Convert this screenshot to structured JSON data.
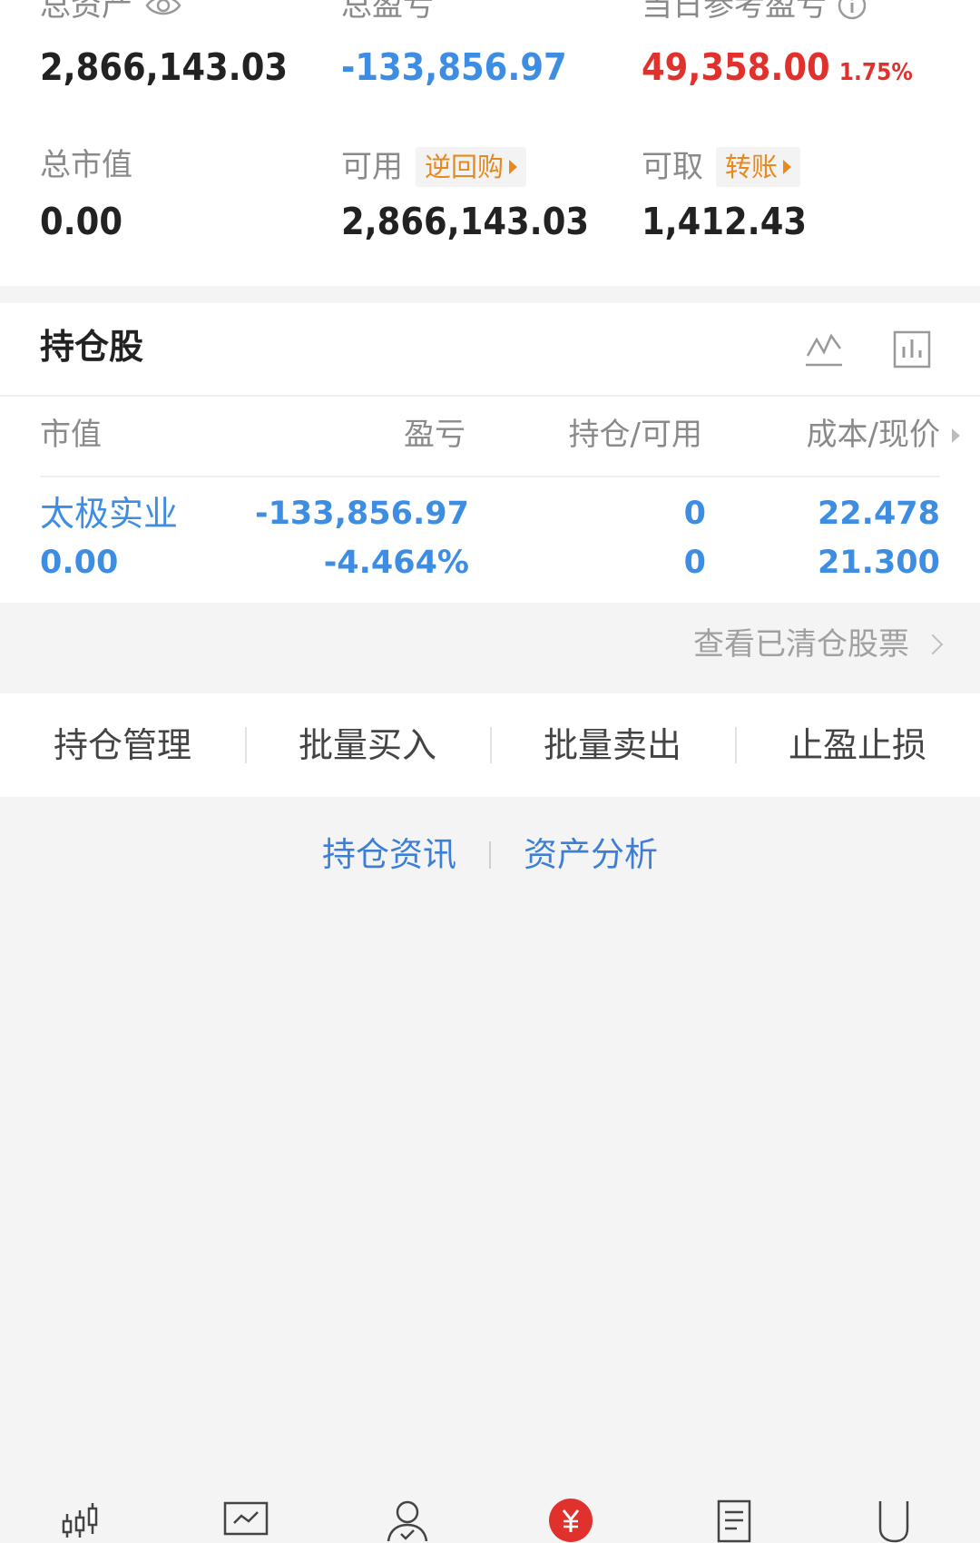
{
  "summary": {
    "total_assets_label": "总资产",
    "total_assets": "2,866,143.03",
    "total_pl_label": "总盈亏",
    "total_pl": "-133,856.97",
    "daily_pl_label": "当日参考盈亏",
    "daily_pl": "49,358.00",
    "daily_pl_pct": "1.75%",
    "market_value_label": "总市值",
    "market_value": "0.00",
    "available_label": "可用",
    "repo_tag": "逆回购",
    "available": "2,866,143.03",
    "withdrawable_label": "可取",
    "transfer_tag": "转账",
    "withdrawable": "1,412.43"
  },
  "holdings": {
    "title": "持仓股",
    "columns": [
      "市值",
      "盈亏",
      "持仓/可用",
      "成本/现价"
    ],
    "rows": [
      {
        "name": "太极实业",
        "market_value": "0.00",
        "pl": "-133,856.97",
        "pl_pct": "-4.464%",
        "position": "0",
        "available": "0",
        "cost": "22.478",
        "price": "21.300"
      }
    ],
    "cleared_link": "查看已清仓股票"
  },
  "actions": [
    "持仓管理",
    "批量买入",
    "批量卖出",
    "止盈止损"
  ],
  "links": {
    "holding_news": "持仓资讯",
    "asset_analysis": "资产分析"
  },
  "colors": {
    "blue": "#3d8ee3",
    "red": "#e0312c",
    "orange": "#e8891f",
    "link_blue": "#3d7fd6"
  },
  "tabbar": {
    "icons": [
      "candlestick-icon",
      "trend-chart-icon",
      "user-check-icon",
      "yuan-icon",
      "document-icon",
      "phone-icon"
    ]
  }
}
